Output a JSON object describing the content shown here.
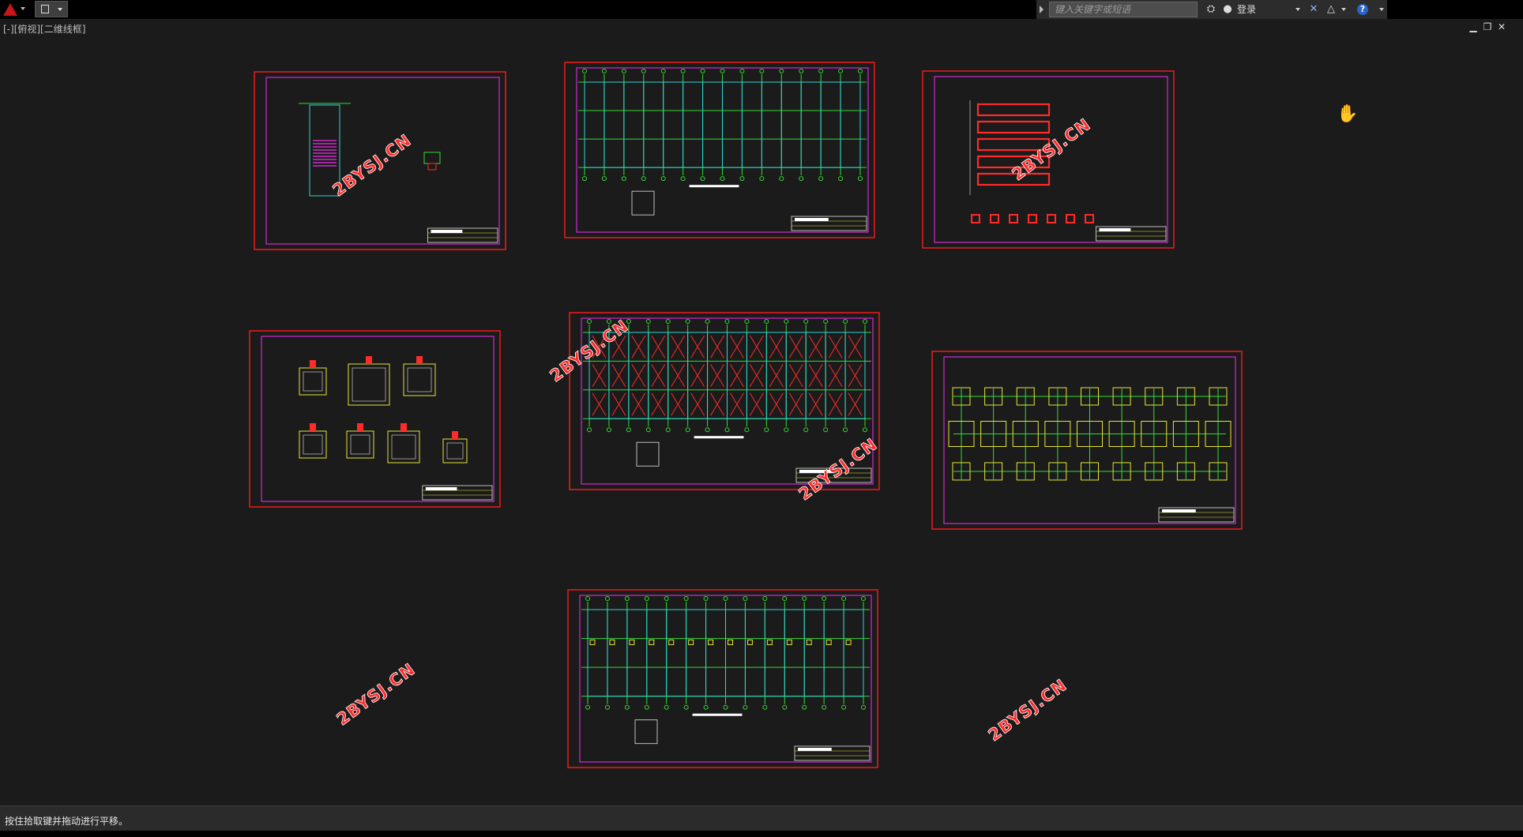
{
  "app": {
    "search_placeholder": "键入关键字或短语",
    "login_label": "登录",
    "help_glyph": "?"
  },
  "viewport": {
    "label": "[-][俯视][二维线框]"
  },
  "watermark": "2BYSJ.CN",
  "status": {
    "prompt": "按住拾取键并拖动进行平移。"
  },
  "colors": {
    "background": "#1b1b1b",
    "sheet_border": "#ff1a1a",
    "inner_border": "#d02ad0",
    "axis_lines": "#32dc32",
    "beams": "#2fd6d6",
    "foundations": "#e6e636",
    "rebar": "#ff2a2a"
  },
  "icons": {
    "app_menu": "autocad-logo-icon",
    "quick_access": "document-icon",
    "search": "binoculars-icon",
    "user": "user-icon",
    "exchange": "exchange-x-icon",
    "a360": "a360-triangle-icon",
    "help": "help-icon",
    "pan_cursor": "hand-pan-icon"
  }
}
